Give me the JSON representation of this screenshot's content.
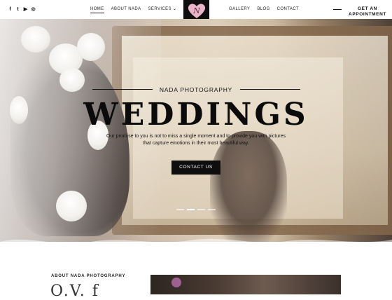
{
  "header": {
    "social_icons": [
      "facebook-icon",
      "twitter-icon",
      "youtube-icon",
      "instagram-icon"
    ],
    "social_glyphs": [
      "f",
      "t",
      "▶",
      "◎"
    ],
    "nav_left": [
      {
        "label": "HOME",
        "active": true
      },
      {
        "label": "ABOUT NADA",
        "active": false
      },
      {
        "label": "SERVICES ⌄",
        "active": false
      }
    ],
    "logo_letter": "N",
    "nav_right": [
      {
        "label": "GALLERY"
      },
      {
        "label": "BLOG"
      },
      {
        "label": "CONTACT"
      }
    ],
    "appointment_line1": "GET AN",
    "appointment_line2": "APPOINTMENT"
  },
  "hero": {
    "subtitle": "NADA PHOTOGRAPHY",
    "title": "WEDDINGS",
    "description": "Our promise to you is not to miss a single moment and to provide you with pictures that capture emotions in their most beautiful way.",
    "button_label": "CONTACT US",
    "slides": 4,
    "active_slide": 2
  },
  "about": {
    "label": "ABOUT NADA PHOTOGRAPHY",
    "heading_partial": "O.V.  f"
  },
  "colors": {
    "dark": "#0e0e0e",
    "logo_heart": "#e9b6c9",
    "text": "#111111"
  }
}
